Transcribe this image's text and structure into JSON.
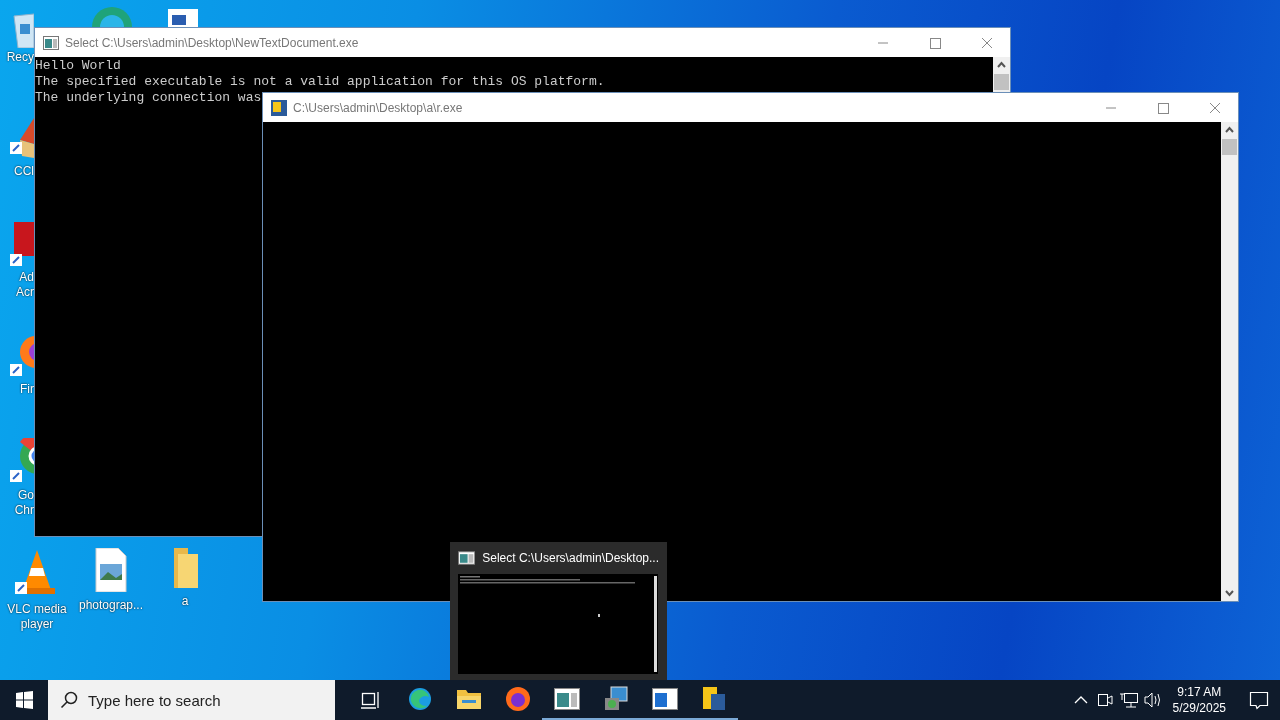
{
  "desktop": {
    "side_icons": [
      {
        "label": "Recy"
      },
      {
        "label": "CCl"
      },
      {
        "label": "Ad Acr"
      },
      {
        "label": "Fir"
      },
      {
        "label": "Go Chr"
      }
    ],
    "bottom_icons": [
      {
        "label": "VLC media player"
      },
      {
        "label": "photograp..."
      },
      {
        "label": "a"
      }
    ]
  },
  "windows": [
    {
      "title": "Select C:\\Users\\admin\\Desktop\\NewTextDocument.exe",
      "lines": [
        "Hello World",
        "The specified executable is not a valid application for this OS platform.",
        "The underlying connection was"
      ]
    },
    {
      "title": "C:\\Users\\admin\\Desktop\\a\\r.exe"
    }
  ],
  "preview": {
    "title": "Select C:\\Users\\admin\\Desktop..."
  },
  "taskbar": {
    "search": {
      "placeholder": "Type here to search"
    },
    "apps": [
      {
        "running": false
      },
      {
        "running": false
      },
      {
        "running": false
      },
      {
        "running": true
      },
      {
        "running": true
      },
      {
        "running": true
      },
      {
        "running": true
      }
    ],
    "clock": {
      "time": "9:17 AM",
      "date": "5/29/2025"
    }
  }
}
